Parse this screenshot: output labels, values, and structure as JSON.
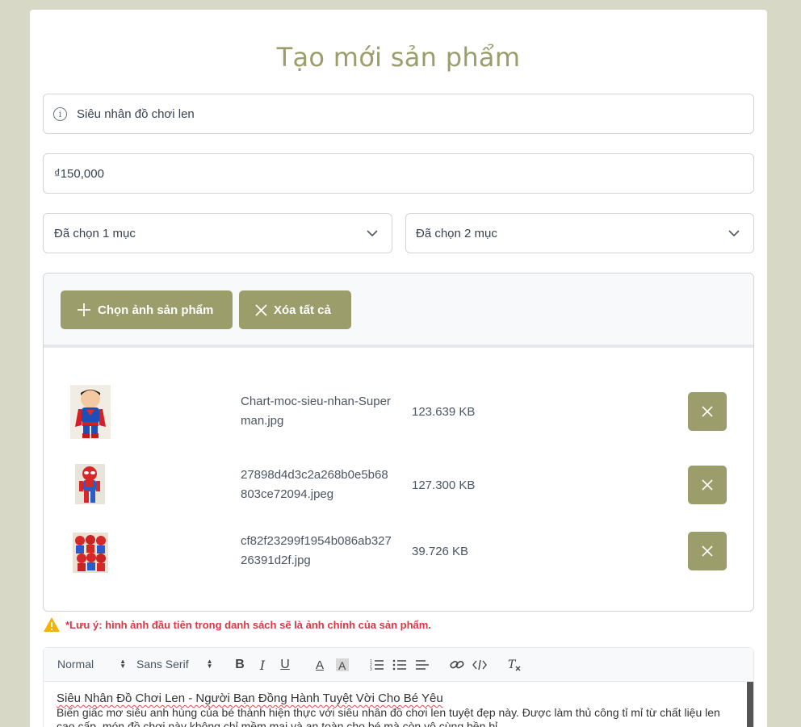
{
  "page": {
    "title": "Tạo mới sản phẩm"
  },
  "form": {
    "name_value": "Siêu nhân đồ chơi len",
    "price_value": "₫150,000",
    "select1_value": "Đã chọn 1 mục",
    "select2_value": "Đã chọn 2 mục"
  },
  "upload": {
    "choose_label": "Chọn ảnh sản phẩm",
    "clear_label": "Xóa tất cả",
    "files": [
      {
        "name": "Chart-moc-sieu-nhan-Superman.jpg",
        "size": "123.639 KB"
      },
      {
        "name": "27898d4d3c2a268b0e5b68803ce72094.jpeg",
        "size": "127.300 KB"
      },
      {
        "name": "cf82f23299f1954b086ab32726391d2f.jpg",
        "size": "39.726 KB"
      }
    ]
  },
  "note": "*Lưu ý: hình ảnh đầu tiên trong danh sách sẽ là ảnh chính của sản phẩm.",
  "editor": {
    "format_select": "Normal",
    "font_select": "Sans Serif",
    "content_title": "Siêu Nhân Đồ Chơi Len - Người Bạn Đồng Hành Tuyệt Vời Cho Bé Yêu",
    "content_body": "Biến giấc mơ siêu anh hùng của bé thành hiện thực với siêu nhân đồ chơi len tuyệt đẹp này. Được làm thủ công tỉ mỉ từ chất liệu len cao cấp, món đồ chơi này không chỉ mềm mại và an toàn cho bé mà còn vô cùng bền bỉ."
  },
  "colors": {
    "accent": "#9b9e6b",
    "background": "#d7d8c6",
    "warning": "#dc3545"
  }
}
